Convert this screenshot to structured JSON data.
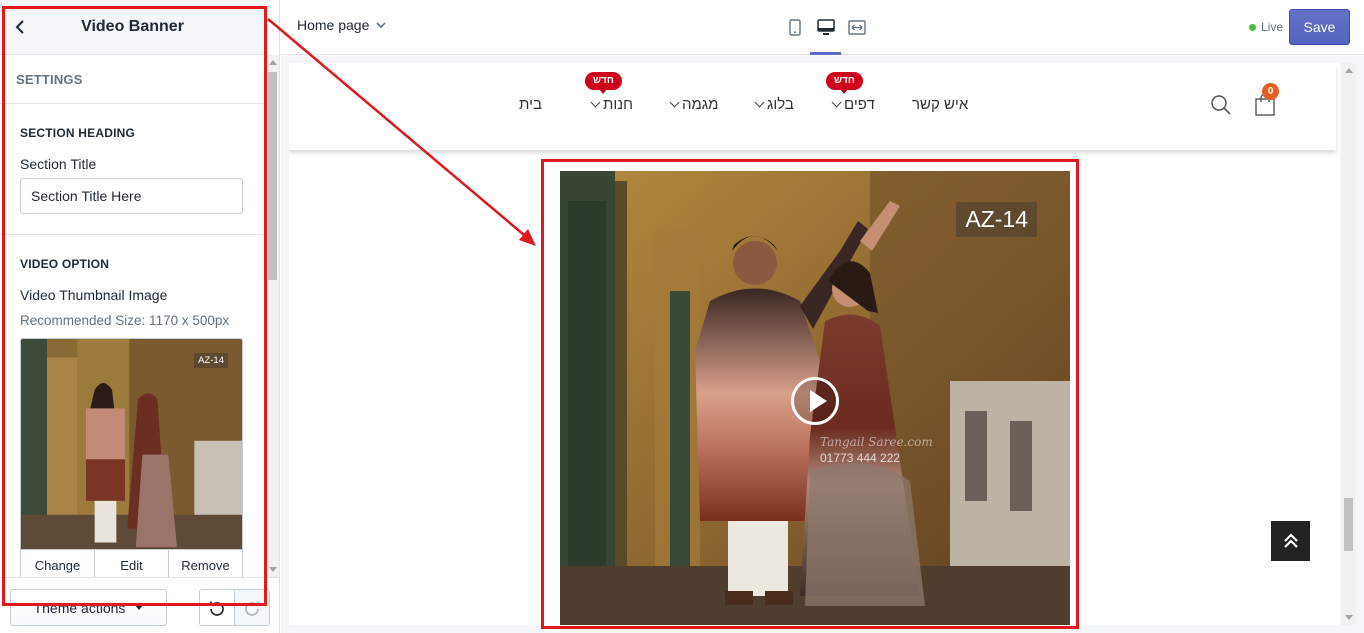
{
  "sidebar": {
    "title": "Video Banner",
    "settings_label": "SETTINGS",
    "section_heading": {
      "heading": "SECTION HEADING",
      "field_label": "Section Title",
      "field_value": "Section Title Here"
    },
    "video_option": {
      "heading": "VIDEO OPTION",
      "thumbnail_label": "Video Thumbnail Image",
      "help": "Recommended Size: 1170 x 500px",
      "thumbnail_badge": "AZ-14",
      "actions": [
        "Change",
        "Edit",
        "Remove"
      ]
    },
    "footer": {
      "theme_actions": "Theme actions"
    }
  },
  "topbar": {
    "page": "Home page",
    "devices": [
      "mobile-icon",
      "desktop-icon",
      "fullwidth-icon"
    ],
    "active_device": "desktop-icon",
    "live": "Live",
    "save": "Save"
  },
  "store": {
    "nav": [
      {
        "label": "איש קשר",
        "dropdown": false
      },
      {
        "label": "דפים",
        "dropdown": true,
        "badge": "חדש"
      },
      {
        "label": "בלוג",
        "dropdown": true
      },
      {
        "label": "מגמה",
        "dropdown": true
      },
      {
        "label": "חנות",
        "dropdown": true,
        "badge": "חדש"
      },
      {
        "label": "בית",
        "dropdown": false
      }
    ],
    "cart_count": "0",
    "banner": {
      "label": "AZ-14",
      "watermark_brand": "Tangail Saree.com",
      "watermark_phone": "01773 444 222"
    }
  },
  "colors": {
    "accent": "#5c6ac4",
    "live_dot": "#50b83c",
    "annotation": "#e0191f",
    "badge_red": "#d0021b",
    "cart_badge": "#e85d21"
  }
}
